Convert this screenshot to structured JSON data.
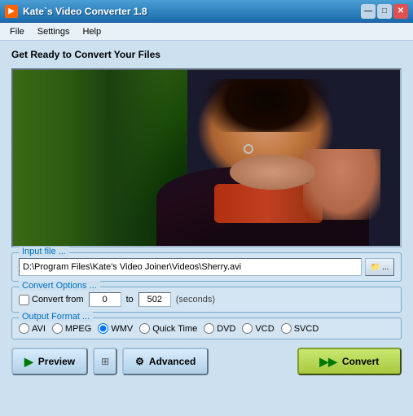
{
  "titlebar": {
    "title": "Kate`s Video Converter 1.8",
    "icon": "▶",
    "buttons": {
      "minimize": "—",
      "maximize": "□",
      "close": "✕"
    }
  },
  "menubar": {
    "items": [
      "File",
      "Settings",
      "Help"
    ]
  },
  "main": {
    "header": "Get Ready to Convert Your Files",
    "input_file": {
      "legend": "Input file ...",
      "value": "D:\\Program Files\\Kate's Video Joiner\\Videos\\Sherry.avi",
      "browse_label": "..."
    },
    "convert_options": {
      "legend": "Convert Options ...",
      "checkbox_label": "Convert from",
      "from_value": "0",
      "to_value": "502",
      "seconds_label": "(seconds)"
    },
    "output_format": {
      "legend": "Output Format ...",
      "options": [
        "AVI",
        "MPEG",
        "WMV",
        "Quick Time",
        "DVD",
        "VCD",
        "SVCD"
      ],
      "selected": "WMV"
    },
    "buttons": {
      "preview_label": "Preview",
      "advanced_label": "Advanced",
      "convert_label": "Convert"
    }
  }
}
